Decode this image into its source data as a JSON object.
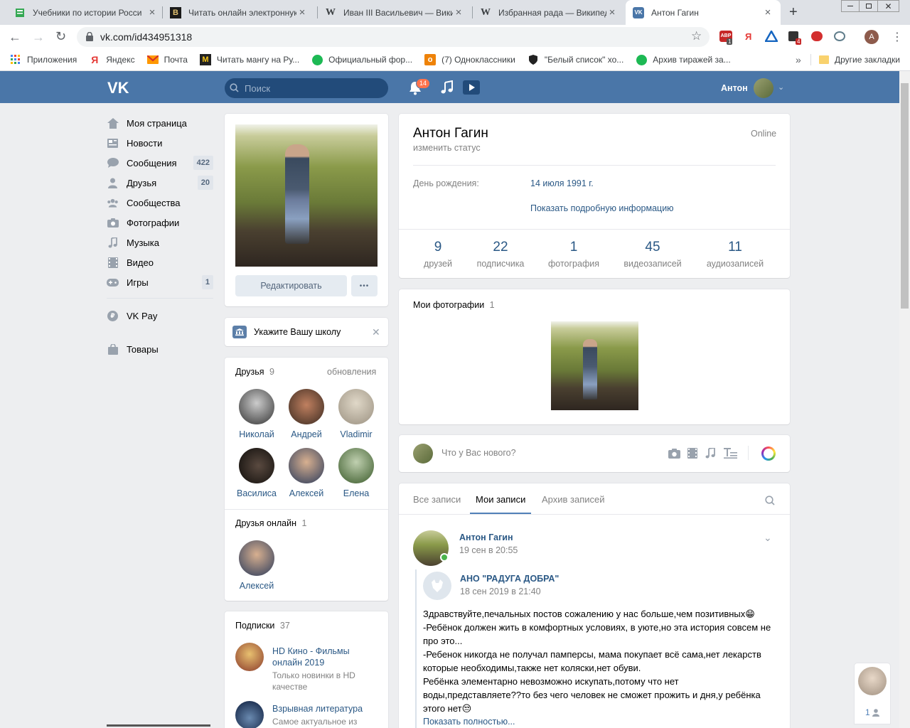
{
  "browser": {
    "tabs": [
      {
        "title": "Учебники по истории Росси",
        "icon": "book-icon",
        "color": "#34a853"
      },
      {
        "title": "Читать онлайн электроннук",
        "icon": "b-logo-icon",
        "color": "#1a1a1a"
      },
      {
        "title": "Иван III Васильевич — Вики",
        "icon": "wikipedia-icon",
        "color": "#000000"
      },
      {
        "title": "Избранная рада — Википед",
        "icon": "wikipedia-icon",
        "color": "#000000"
      },
      {
        "title": "Антон Гагин",
        "icon": "vk-icon",
        "color": "#4a76a8"
      }
    ],
    "new_tab": "+",
    "url": "vk.com/id434951318",
    "profile_letter": "A",
    "ext_badges": [
      "1",
      "4"
    ],
    "bookmarks": [
      {
        "label": "Приложения",
        "icon": "apps-grid-icon"
      },
      {
        "label": "Яндекс",
        "icon": "yandex-icon"
      },
      {
        "label": "Почта",
        "icon": "mail-icon"
      },
      {
        "label": "Читать мангу на Ру...",
        "icon": "m-logo-icon"
      },
      {
        "label": "Официальный фор...",
        "icon": "forum-icon"
      },
      {
        "label": "(7) Одноклассники",
        "icon": "ok-icon"
      },
      {
        "label": "\"Белый список\" хо...",
        "icon": "shield-icon"
      },
      {
        "label": "Архив тиражей за...",
        "icon": "forum-icon"
      }
    ],
    "bookmarks_overflow": "»",
    "other_bookmarks": "Другие закладки"
  },
  "header": {
    "search_placeholder": "Поиск",
    "notifications_count": "14",
    "user_name": "Антон"
  },
  "menu": [
    {
      "label": "Моя страница",
      "icon": "home-icon",
      "count": ""
    },
    {
      "label": "Новости",
      "icon": "news-icon",
      "count": ""
    },
    {
      "label": "Сообщения",
      "icon": "message-icon",
      "count": "422"
    },
    {
      "label": "Друзья",
      "icon": "friends-icon",
      "count": "20"
    },
    {
      "label": "Сообщества",
      "icon": "groups-icon",
      "count": ""
    },
    {
      "label": "Фотографии",
      "icon": "camera-icon",
      "count": ""
    },
    {
      "label": "Музыка",
      "icon": "music-icon",
      "count": ""
    },
    {
      "label": "Видео",
      "icon": "video-icon",
      "count": ""
    },
    {
      "label": "Игры",
      "icon": "games-icon",
      "count": "1"
    }
  ],
  "menu_extra": [
    {
      "label": "VK Pay",
      "icon": "vkpay-icon"
    },
    {
      "label": "Товары",
      "icon": "bag-icon"
    }
  ],
  "profile": {
    "edit_button": "Редактировать",
    "more_button": "•••",
    "school_prompt": "Укажите Вашу школу",
    "name": "Антон Гагин",
    "status_link": "изменить статус",
    "online": "Online",
    "birthday_label": "День рождения:",
    "birthday_value": "14 июля 1991 г.",
    "more_info": "Показать подробную информацию",
    "stats": [
      {
        "n": "9",
        "l": "друзей"
      },
      {
        "n": "22",
        "l": "подписчика"
      },
      {
        "n": "1",
        "l": "фотография"
      },
      {
        "n": "45",
        "l": "видеозаписей"
      },
      {
        "n": "11",
        "l": "аудиозаписей"
      }
    ]
  },
  "friends": {
    "title": "Друзья",
    "count": "9",
    "updates": "обновления",
    "items": [
      {
        "name": "Николай",
        "color": "#555555"
      },
      {
        "name": "Андрей",
        "color": "#6b4a3a"
      },
      {
        "name": "Vladimir",
        "color": "#b8b0a0"
      },
      {
        "name": "Василиса",
        "color": "#2a2420"
      },
      {
        "name": "Алексей",
        "color": "#4a5568"
      },
      {
        "name": "Елена",
        "color": "#6a8a5a"
      }
    ]
  },
  "friends_online": {
    "title": "Друзья онлайн",
    "count": "1",
    "items": [
      {
        "name": "Алексей",
        "color": "#4a5568"
      }
    ]
  },
  "subscriptions": {
    "title": "Подписки",
    "count": "37",
    "items": [
      {
        "name": "HD Кино - Фильмы онлайн 2019",
        "desc": "Только новинки в HD качестве",
        "color": "#8a3a2a"
      },
      {
        "name": "Взрывная литература",
        "desc": "Самое актуальное из",
        "color": "#1a2a4a"
      }
    ]
  },
  "photos": {
    "title": "Мои фотографии",
    "count": "1"
  },
  "composer": {
    "placeholder": "Что у Вас нового?"
  },
  "wall": {
    "tabs": [
      "Все записи",
      "Мои записи",
      "Архив записей"
    ],
    "active_tab": 1
  },
  "post": {
    "author": "Антон Гагин",
    "date": "19 сен в 20:55",
    "repost_author": "АНО \"РАДУГА ДОБРА\"",
    "repost_date": "18 сен 2019 в 21:40",
    "lines": [
      "Здравствуйте,печальных постов сожалению у нас больше,чем позитивных😁",
      "-Ребёнок должен жить в комфортных условиях, в уюте,но эта история совсем не про это...",
      "-Ребенок никогда не получал памперсы, мама покупает всё сама,нет лекарств которые необходимы,также нет коляски,нет обуви.",
      "Ребёнка элементарно невозможно искупать,потому что нет воды,представляете??то без чего человек не сможет прожить и дня,у ребёнка этого нет😒"
    ],
    "show_more": "Показать полностью..."
  },
  "chat_widget": {
    "count": "1"
  }
}
